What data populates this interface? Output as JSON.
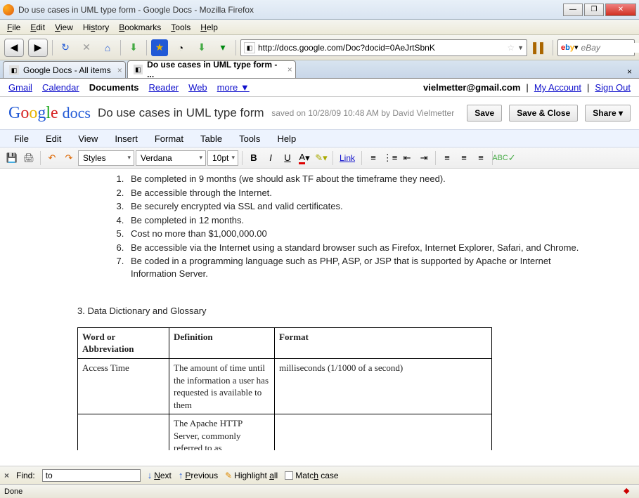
{
  "window": {
    "title": "Do use cases in UML type form - Google Docs - Mozilla Firefox"
  },
  "browser_menu": {
    "file": "File",
    "edit": "Edit",
    "view": "View",
    "history": "History",
    "bookmarks": "Bookmarks",
    "tools": "Tools",
    "help": "Help"
  },
  "url": "http://docs.google.com/Doc?docid=0AeJrtSbnK",
  "search_placeholder": "eBay",
  "tabs": [
    {
      "label": "Google Docs - All items"
    },
    {
      "label": "Do use cases in UML type form - ..."
    }
  ],
  "gbar": {
    "links": [
      "Gmail",
      "Calendar",
      "Documents",
      "Reader",
      "Web",
      "more ▼"
    ],
    "active_index": 2,
    "email": "vielmetter@gmail.com",
    "account": "My Account",
    "signout": "Sign Out"
  },
  "docs": {
    "doc_title": "Do use cases in UML type form",
    "saved": "saved on 10/28/09 10:48 AM by David Vielmetter",
    "save": "Save",
    "save_close": "Save & Close",
    "share": "Share ▾",
    "menu": [
      "File",
      "Edit",
      "View",
      "Insert",
      "Format",
      "Table",
      "Tools",
      "Help"
    ],
    "style_sel": "Styles",
    "font_sel": "Verdana",
    "size_sel": "10pt",
    "link": "Link"
  },
  "content": {
    "list": [
      "Be completed in 9 months (we should ask TF about the timeframe they need).",
      "Be accessible through the Internet.",
      "Be securely encrypted via SSL and valid certificates.",
      "Be completed in 12 months.",
      "Cost no more than $1,000,000.00",
      "Be accessible via the Internet using a standard browser such as Firefox, Internet Explorer, Safari, and Chrome.",
      "Be coded in a programming language such as PHP, ASP, or JSP that is supported by Apache or Internet Information Server."
    ],
    "sec3_title": "3. Data Dictionary and Glossary",
    "th1": "Word or Abbreviation",
    "th2": "Definition",
    "th3": "Format",
    "r1c1": "Access Time",
    "r1c2": "The amount of time until the information a user has requested is available to them",
    "r1c3": "milliseconds (1/1000 of a second)",
    "r2c1": "",
    "r2c2": "The Apache HTTP Server, commonly referred to as",
    "r2c3": ""
  },
  "find": {
    "label": "Find:",
    "value": "to",
    "next": "Next",
    "prev": "Previous",
    "hl": "Highlight all",
    "match": "Match case"
  },
  "status": {
    "text": "Done"
  }
}
